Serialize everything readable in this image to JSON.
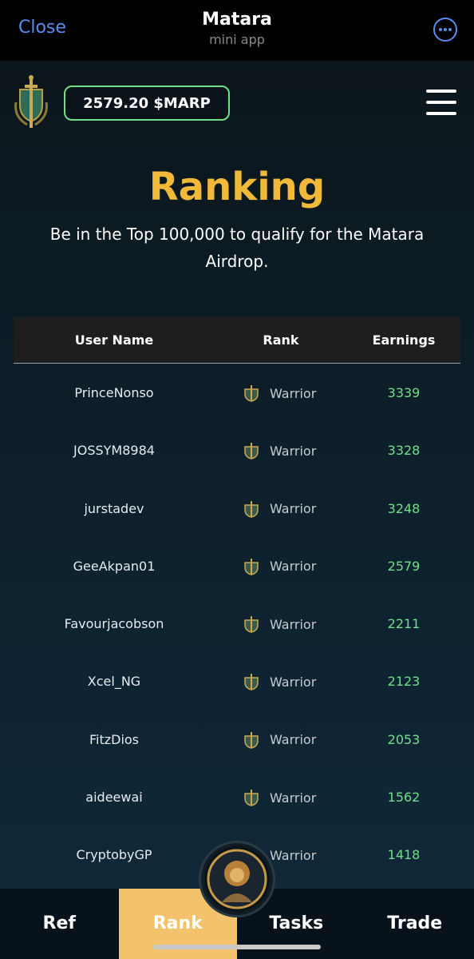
{
  "telegram": {
    "close_label": "Close",
    "title": "Matara",
    "subtitle": "mini app",
    "more_icon": "more-horizontal-icon"
  },
  "header": {
    "logo_icon": "sword-shield-logo",
    "balance": "2579.20 $MARP",
    "menu_icon": "hamburger-menu-icon",
    "accent_color": "#6fe08a"
  },
  "page": {
    "title": "Ranking",
    "subtitle": "Be in the Top 100,000 to qualify for the Matara Airdrop.",
    "title_color": "#f0b93a"
  },
  "table": {
    "columns": [
      "User Name",
      "Rank",
      "Earnings"
    ],
    "rows": [
      {
        "user": "PrinceNonso",
        "rank": "Warrior",
        "earnings": "3339"
      },
      {
        "user": "JOSSYM8984",
        "rank": "Warrior",
        "earnings": "3328"
      },
      {
        "user": "jurstadev",
        "rank": "Warrior",
        "earnings": "3248"
      },
      {
        "user": "GeeAkpan01",
        "rank": "Warrior",
        "earnings": "2579"
      },
      {
        "user": "Favourjacobson",
        "rank": "Warrior",
        "earnings": "2211"
      },
      {
        "user": "Xcel_NG",
        "rank": "Warrior",
        "earnings": "2123"
      },
      {
        "user": "FitzDios",
        "rank": "Warrior",
        "earnings": "2053"
      },
      {
        "user": "aideewai",
        "rank": "Warrior",
        "earnings": "1562"
      },
      {
        "user": "CryptobyGP",
        "rank": "Warrior",
        "earnings": "1418"
      }
    ],
    "rank_icon": "warrior-helmet-icon",
    "earnings_color": "#6fe08a"
  },
  "nav": {
    "tabs": [
      {
        "label": "Ref",
        "active": false
      },
      {
        "label": "Rank",
        "active": true
      },
      {
        "label": "Tasks",
        "active": false
      },
      {
        "label": "Trade",
        "active": false
      }
    ],
    "active_color": "#f3c26c",
    "avatar_icon": "lion-warrior-avatar"
  }
}
